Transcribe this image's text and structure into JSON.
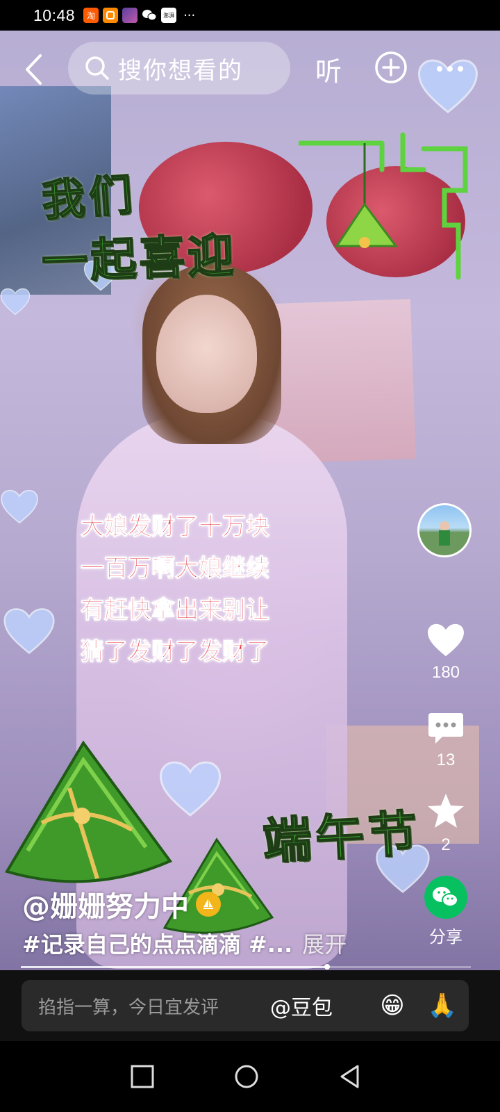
{
  "status_bar": {
    "time": "10:48",
    "app_icons": [
      "taobao-icon",
      "app-icon",
      "photo-icon",
      "wechat-icon",
      "news-icon"
    ],
    "taobao_label": "淘",
    "news_label": "澎湃",
    "overflow": "···"
  },
  "top_bar": {
    "search_placeholder": "搜你想看的",
    "listen_label": "听"
  },
  "video_overlay": {
    "sticker_line1": "我们",
    "sticker_line2": "一起喜迎",
    "sticker_bottom": "端午节",
    "caption_lines": [
      "大娘发财了十万块",
      "一百万啊大娘继续",
      "有赶快拿出来别让",
      "猜了发财了发财了"
    ]
  },
  "actions": {
    "like_count": "180",
    "comment_count": "13",
    "favorite_count": "2",
    "share_label": "分享"
  },
  "post": {
    "author": "@姗姗努力中",
    "description": "#记录自己的点点滴滴 #...",
    "expand_label": "展开",
    "progress_fraction": 0.68
  },
  "comment_bar": {
    "placeholder": "掐指一算，今日宜发评",
    "doubao_label": "@豆包",
    "emoji_grin": "😁",
    "emoji_pray": "🙏"
  },
  "colors": {
    "caption_red": "#e8303a",
    "sticker_green": "#3a9f2c",
    "wechat_green": "#07c160"
  }
}
